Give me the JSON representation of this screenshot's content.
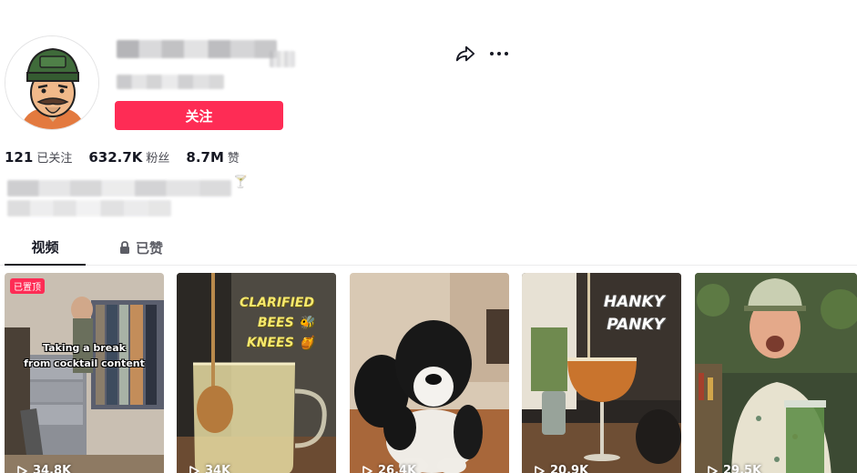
{
  "profile": {
    "follow_label": "关注",
    "bio_emoji": "🍸"
  },
  "stats": {
    "following_count": "121",
    "following_label": "已关注",
    "followers_count": "632.7K",
    "followers_label": "粉丝",
    "likes_count": "8.7M",
    "likes_label": "赞"
  },
  "tabs": {
    "videos_label": "视频",
    "liked_label": "已赞"
  },
  "videos": [
    {
      "views": "34.8K",
      "badge": "已置顶",
      "overlay_line1": "Taking a break",
      "overlay_line2": "from cocktail content"
    },
    {
      "views": "34K",
      "overlay_line1": "CLARIFIED",
      "overlay_line2": "BEES 🐝",
      "overlay_line3": "KNEES 🍯"
    },
    {
      "views": "26.4K"
    },
    {
      "views": "20.9K",
      "overlay_line1": "HANKY",
      "overlay_line2": "PANKY"
    },
    {
      "views": "29.5K"
    }
  ],
  "icons": {
    "share": "share-icon",
    "more": "more-icon",
    "lock": "lock-icon",
    "play": "play-icon"
  },
  "colors": {
    "accent": "#fe2c55",
    "text": "#161823",
    "secondary_text": "#4a4b53"
  }
}
